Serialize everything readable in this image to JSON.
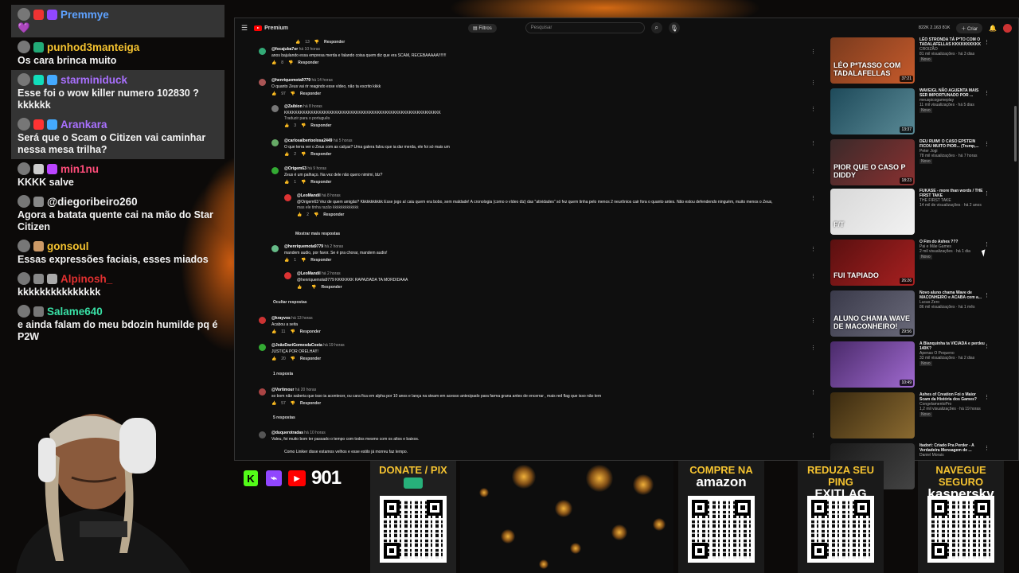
{
  "chat": [
    {
      "user": "Premmye",
      "color": "#5ea2ff",
      "text": "💜",
      "highlight": true,
      "badges": [
        "#e33",
        "#9147ff"
      ]
    },
    {
      "user": "punhod3manteiga",
      "color": "#f5c330",
      "text": "Os cara brinca muito",
      "highlight": false,
      "badges": [
        "#2a7"
      ]
    },
    {
      "user": "starminiduck",
      "color": "#a970ff",
      "text": "Esse foi o wow killer numero 102830 ? kkkkkk",
      "highlight": true,
      "badges": [
        "#1db",
        "#4af"
      ]
    },
    {
      "user": "Arankara",
      "color": "#a970ff",
      "text": "Será que o Scam o Citizen vai caminhar nessa mesa trilha?",
      "highlight": true,
      "badges": [
        "#f33",
        "#4af"
      ]
    },
    {
      "user": "min1nu",
      "color": "#ff4d7a",
      "text": "KKKK salve",
      "highlight": false,
      "badges": [
        "#ccc",
        "#b4f"
      ]
    },
    {
      "user": "@diegoribeiro260",
      "color": "#f2f2f2",
      "text": "Agora a batata quente cai na mão do Star Citizen",
      "highlight": false,
      "badges": [
        "#888"
      ]
    },
    {
      "user": "gonsoul",
      "color": "#f5c330",
      "text": "Essas expressões faciais, esses miados",
      "highlight": false,
      "badges": [
        "#c96"
      ]
    },
    {
      "user": "Alpinosh_",
      "color": "#e23030",
      "text": "kkkkkkkkkkkkkkk",
      "highlight": false,
      "badges": [
        "#888",
        "#aaa"
      ]
    },
    {
      "user": "Salame640",
      "color": "#39e1a6",
      "text": "e ainda falam do meu bdozin humilde pq é P2W",
      "highlight": false,
      "badges": [
        "#777"
      ]
    }
  ],
  "youtube": {
    "brand": "Premium",
    "filters": "Filtros",
    "search_placeholder": "Pesquisar",
    "create": "Criar",
    "stats": "822K  2.163  81K",
    "show_more": "Mostrar mais respostas",
    "hide_replies": "Ocultar respostas",
    "one_reply": "1 resposta",
    "five_replies": "5 respostas",
    "comments": [
      {
        "user": "",
        "time": "",
        "text": "",
        "likes": "13",
        "reply": "Responder"
      },
      {
        "user": "@focajuba7or",
        "time": "há 10 horas",
        "text": "anos bajulando essa empresa merda e falando coisa quem diz que era SCAM, RECEBAAAAA!!!!!!!",
        "likes": "8",
        "reply": "Responder"
      },
      {
        "user": "@henriquemota9779",
        "time": "há 14 horas",
        "text": "O quanto Zeus vai rir reagindo esse vídeo, não ta escrito kkkk",
        "likes": "97",
        "reply": "Responder"
      },
      {
        "user": "@Zaibion",
        "time": "há 8 horas",
        "text": "KKKKKKKKKKKKKKKKKKKKKKKKKKKKKKKKKKKKKKKKKKKKKKKKKKKKKKKKKKK",
        "sub": "Traduzir para o português",
        "likes": "3",
        "reply": "Responder"
      },
      {
        "user": "@carlosalbertoolosa2449",
        "time": "há 5 horas",
        "text": "O que terra ver o Zeus com as calças? Uma galera falou que ia dar merda, ele foi só mais um",
        "likes": "2",
        "reply": "Responder"
      },
      {
        "user": "@Origem63",
        "time": "há 9 horas",
        "text": "Zeus é um palhaço. Na vez dele não quero nimimi, blz?",
        "likes": "1",
        "reply": "Responder"
      },
      {
        "user": "@LeoMandil",
        "time": "há 8 horas",
        "text": "@Origem63 Vez de quem amigão? Kkkkkkkkkkk Esse jogo aí caiu quem era bobo, sem maldade! A cronologia (como o vídeo diz) das \"atividades\" só fez quem tinha pelo menos 2 neurônios cair fora o quanto antes. Não estou defendendo ninguém, muito menos o Zeus,",
        "sub": "mas ele tinha razão kkkkkkkkkkkkk",
        "likes": "2",
        "reply": "Responder"
      },
      {
        "user": "@henriquemota9779",
        "time": "há 2 horas",
        "text": "mandem audio, por favor. Se é pra chorar, mandem audio!",
        "likes": "1",
        "reply": "Responder"
      },
      {
        "user": "@LeoMandil",
        "time": "há 2 horas",
        "text": "@henriquemota9779 KKKKKKK RAPAZIADA TA MORDIDAAA",
        "likes": "",
        "reply": "Responder"
      },
      {
        "user": "@krayvos",
        "time": "há 13 horas",
        "text": "Acabou a seita",
        "likes": "11",
        "reply": "Responder"
      },
      {
        "user": "@JoãoDaviGomesdaCosta",
        "time": "há 19 horas",
        "text": "JUSTIÇA POR ORELHA!!!",
        "likes": "20",
        "reply": "Responder"
      },
      {
        "user": "@Vortimour",
        "time": "há 20 horas",
        "text": "so bom não saberia que isso ia acontecer, ou cara fica em alpha por 10 anos e lança na steam em acesso antecipado para farma grana antes de encerrar , mais red flag que isso não tem",
        "likes": "57",
        "reply": "Responder"
      },
      {
        "user": "@duquerotradas",
        "time": "há 10 horas",
        "text": "Valeu, foi muito bom ter passado o tempo com todos mesmo com os altos e baixos.",
        "likes": "",
        "reply": ""
      },
      {
        "user": "",
        "time": "",
        "text": "Como Liniker disse estamos velhos e esse estilo já morreu faz tempo.",
        "likes": "",
        "reply": ""
      }
    ],
    "recommended": [
      {
        "title": "LÉO STRONDA TÁ P*TO COM O TADALAFELLAS KKKKKKKKKK",
        "channel": "CROIZÃO",
        "meta": "81 mil visualizações · há 3 dias",
        "badge": "Novo",
        "duration": "37:21",
        "overlay": "LÉO P*TASSO COM TADALAFELLAS",
        "c1": "#7a3b1e",
        "c2": "#c65a2b"
      },
      {
        "title": "WAVEIGL NÃO AGUENTA MAIS SER IMPORTUNADO POR ...",
        "channel": "meuspicogameplay",
        "meta": "11 mil visualizações · há 5 dias",
        "badge": "Novo",
        "duration": "13:37",
        "overlay": "",
        "c1": "#1e4a5a",
        "c2": "#5a8a96"
      },
      {
        "title": "DEU RUIM! O CASO EPSTEIN FICOU MUITO PIOR... (Trump,...",
        "channel": "Peter Jogi",
        "meta": "78 mil visualizações · há 7 horas",
        "badge": "Novo",
        "duration": "18:23",
        "overlay": "PIOR QUE O CASO P DIDDY",
        "c1": "#3a2a2a",
        "c2": "#8a3030"
      },
      {
        "title": "FUKASE - more than words / THE FIRST TAKE",
        "channel": "THE FIRST TAKE",
        "meta": "14 mil de visualizações · há 2 anos",
        "badge": "",
        "duration": "",
        "overlay": "F/T",
        "c1": "#d8d8d8",
        "c2": "#f2f2f2"
      },
      {
        "title": "O Fim do Ashes ???",
        "channel": "Pai e Mãe Games",
        "meta": "2 mil visualizações · há 1 dia",
        "badge": "Novo",
        "duration": "26:26",
        "overlay": "FUI TAPIADO",
        "c1": "#5a1010",
        "c2": "#a82020"
      },
      {
        "title": "Novo aluno chama Wave de MACONHEIRO e ACABA com a...",
        "channel": "Lucas Zero",
        "meta": "86 mil visualizações · há 1 mês",
        "badge": "",
        "duration": "29:56",
        "overlay": "ALUNO CHAMA WAVE DE MACONHEIRO!",
        "c1": "#3a3a4a",
        "c2": "#6a6a7a"
      },
      {
        "title": "A Blanquinha ta VICIADA e perdeu 140K?",
        "channel": "Apenas O Pequeno",
        "meta": "33 mil visualizações · há 2 dias",
        "badge": "Novo",
        "duration": "10:49",
        "overlay": "",
        "c1": "#4a2a6a",
        "c2": "#a06ad0"
      },
      {
        "title": "Ashes of Creation Foi o Maior Scam da História dos Games?",
        "channel": "CongelamentoPro",
        "meta": "1,2 mil visualizações · há 19 horas",
        "badge": "Novo",
        "duration": "",
        "overlay": "",
        "c1": "#3a2a10",
        "c2": "#8a6a30"
      },
      {
        "title": "Itadori: Criado Pra Perder - A Verdadeira Mensagem de ...",
        "channel": "Daniel Morais",
        "meta": "",
        "badge": "",
        "duration": "",
        "overlay": "O MAIS",
        "c1": "#1a1a1a",
        "c2": "#444"
      }
    ]
  },
  "bottom": {
    "follower_count": "901",
    "qr_cards": [
      {
        "head": "DONATE / PIX",
        "sub": ""
      },
      {
        "head": "COMPRE NA",
        "sub": "amazon"
      },
      {
        "head": "REDUZA SEU PING",
        "sub": "EXITLAG"
      },
      {
        "head": "NAVEGUE SEGURO",
        "sub": "kaspersky"
      }
    ]
  }
}
